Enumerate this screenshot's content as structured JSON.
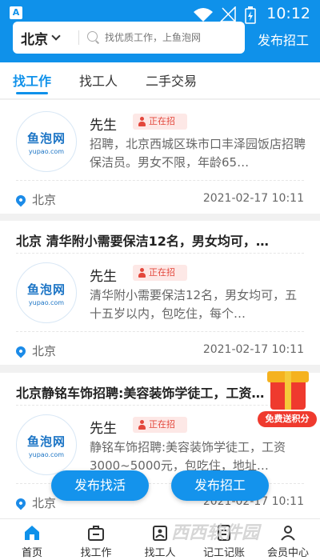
{
  "status_bar": {
    "time": "10:12"
  },
  "header": {
    "city": "北京",
    "search_placeholder": "找优质工作，上鱼泡网",
    "post_button": "发布招工"
  },
  "tabs": [
    {
      "label": "找工作",
      "active": true
    },
    {
      "label": "找工人",
      "active": false
    },
    {
      "label": "二手交易",
      "active": false
    }
  ],
  "logo": {
    "line1": "鱼泡网",
    "line2": "yupao.com"
  },
  "listings": [
    {
      "title": "",
      "poster": "先生",
      "badge": "正在招",
      "desc": "招聘，北京西城区珠市口丰泽园饭店招聘保洁员。男女不限，年龄65…",
      "location": "北京",
      "date": "2021-02-17 10:11"
    },
    {
      "title": "北京  清华附小需要保洁12名，男女均可，…",
      "poster": "先生",
      "badge": "正在招",
      "desc": "清华附小需要保洁12名，男女均可，五十五岁以内，包吃住，每个…",
      "location": "北京",
      "date": "2021-02-17 10:11"
    },
    {
      "title": "北京静铭车饰招聘:美容装饰学徒工，工资…",
      "poster": "先生",
      "badge": "正在招",
      "desc": "静铭车饰招聘:美容装饰学徒工，工资3000~5000元，包吃住，地址…",
      "location": "北京",
      "date": "2021-02-17 10:11"
    }
  ],
  "floating": {
    "left_button": "发布找活",
    "right_button": "发布招工",
    "gift_label": "免费送积分"
  },
  "bottom_nav": [
    {
      "label": "首页",
      "icon": "home-icon",
      "active": true
    },
    {
      "label": "找工作",
      "icon": "briefcase-icon",
      "active": false
    },
    {
      "label": "找工人",
      "icon": "worker-icon",
      "active": false
    },
    {
      "label": "记工记账",
      "icon": "notebook-icon",
      "active": false
    },
    {
      "label": "会员中心",
      "icon": "member-icon",
      "active": false
    }
  ],
  "watermark": "西西软件园",
  "colors": {
    "primary": "#0f91ea",
    "badge_red": "#e3473c",
    "page_bg": "#f1f1f1"
  }
}
